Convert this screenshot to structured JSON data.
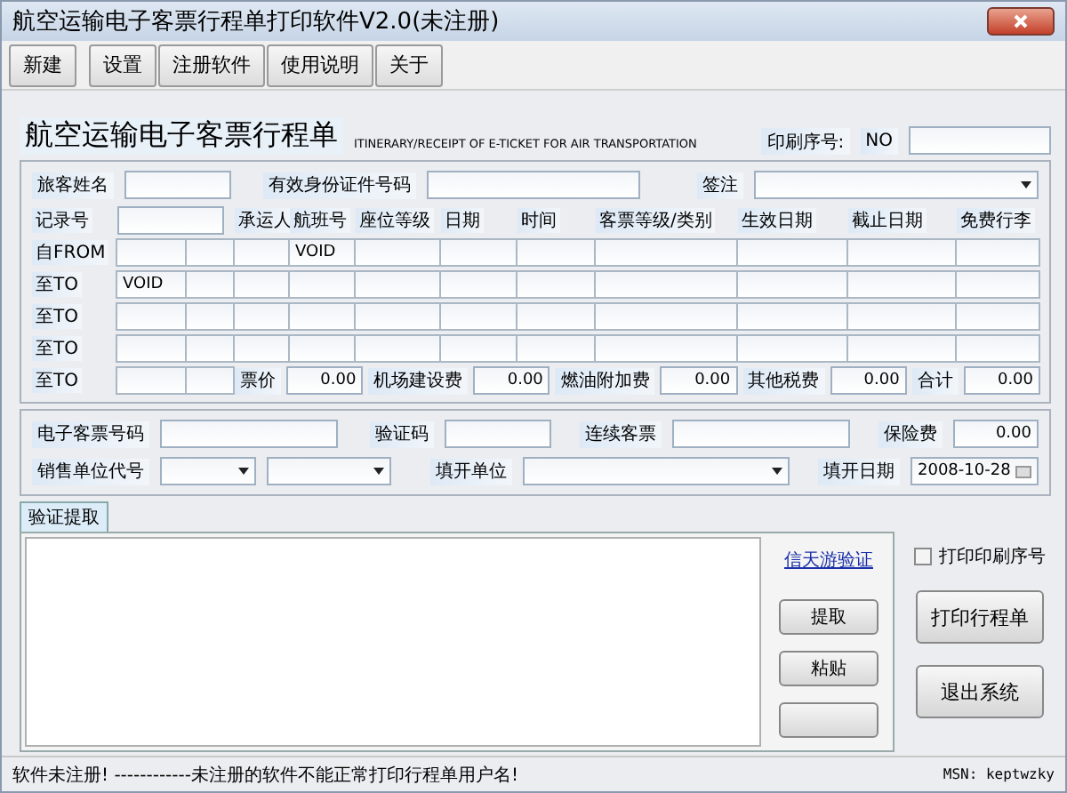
{
  "window": {
    "title": "航空运输电子客票行程单打印软件V2.0(未注册)"
  },
  "toolbar": [
    "新建",
    "设置",
    "注册软件",
    "使用说明",
    "关于"
  ],
  "header": {
    "title": "航空运输电子客票行程单",
    "subtitle": "ITINERARY/RECEIPT OF E-TICKET FOR AIR TRANSPORTATION",
    "serial_label": "印刷序号:",
    "serial_prefix": "NO"
  },
  "passenger": {
    "name_label": "旅客姓名",
    "id_label": "有效身份证件号码",
    "endorsement_label": "签注"
  },
  "record_label": "记录号",
  "columns": [
    "承运人",
    "航班号",
    "座位等级",
    "日期",
    "时间",
    "客票等级/类别",
    "生效日期",
    "截止日期",
    "免费行李"
  ],
  "segments": [
    {
      "label": "自FROM",
      "cells": [
        null,
        null,
        null,
        "VOID",
        null,
        null,
        null,
        null,
        null,
        null,
        null
      ]
    },
    {
      "label": "至TO",
      "cells": [
        "VOID",
        null,
        null,
        null,
        null,
        null,
        null,
        null,
        null,
        null,
        null
      ]
    },
    {
      "label": "至TO",
      "cells": [
        null,
        null,
        null,
        null,
        null,
        null,
        null,
        null,
        null,
        null,
        null
      ]
    },
    {
      "label": "至TO",
      "cells": [
        null,
        null,
        null,
        null,
        null,
        null,
        null,
        null,
        null,
        null,
        null
      ]
    }
  ],
  "last_segment": {
    "label": "至TO"
  },
  "fares": [
    {
      "label": "票价",
      "value": "0.00"
    },
    {
      "label": "机场建设费",
      "value": "0.00"
    },
    {
      "label": "燃油附加费",
      "value": "0.00"
    },
    {
      "label": "其他税费",
      "value": "0.00"
    },
    {
      "label": "合计",
      "value": "0.00"
    }
  ],
  "ticket": {
    "eticket_label": "电子客票号码",
    "verify_label": "验证码",
    "conj_label": "连续客票",
    "insurance_label": "保险费",
    "insurance_value": "0.00",
    "agent_label": "销售单位代号",
    "issuer_label": "填开单位",
    "date_label": "填开日期",
    "date_value": "2008-10-28"
  },
  "tab": {
    "label": "验证提取",
    "selected": true
  },
  "link": "信天游验证",
  "side_buttons": [
    "提取",
    "粘贴"
  ],
  "print_serial": {
    "label": "打印印刷序号",
    "checked": false
  },
  "actions": [
    "打印行程单",
    "退出系统"
  ],
  "status": {
    "message": "软件未注册! ------------未注册的软件不能正常打印行程单用户名!",
    "contact": "MSN: keptwzky"
  }
}
